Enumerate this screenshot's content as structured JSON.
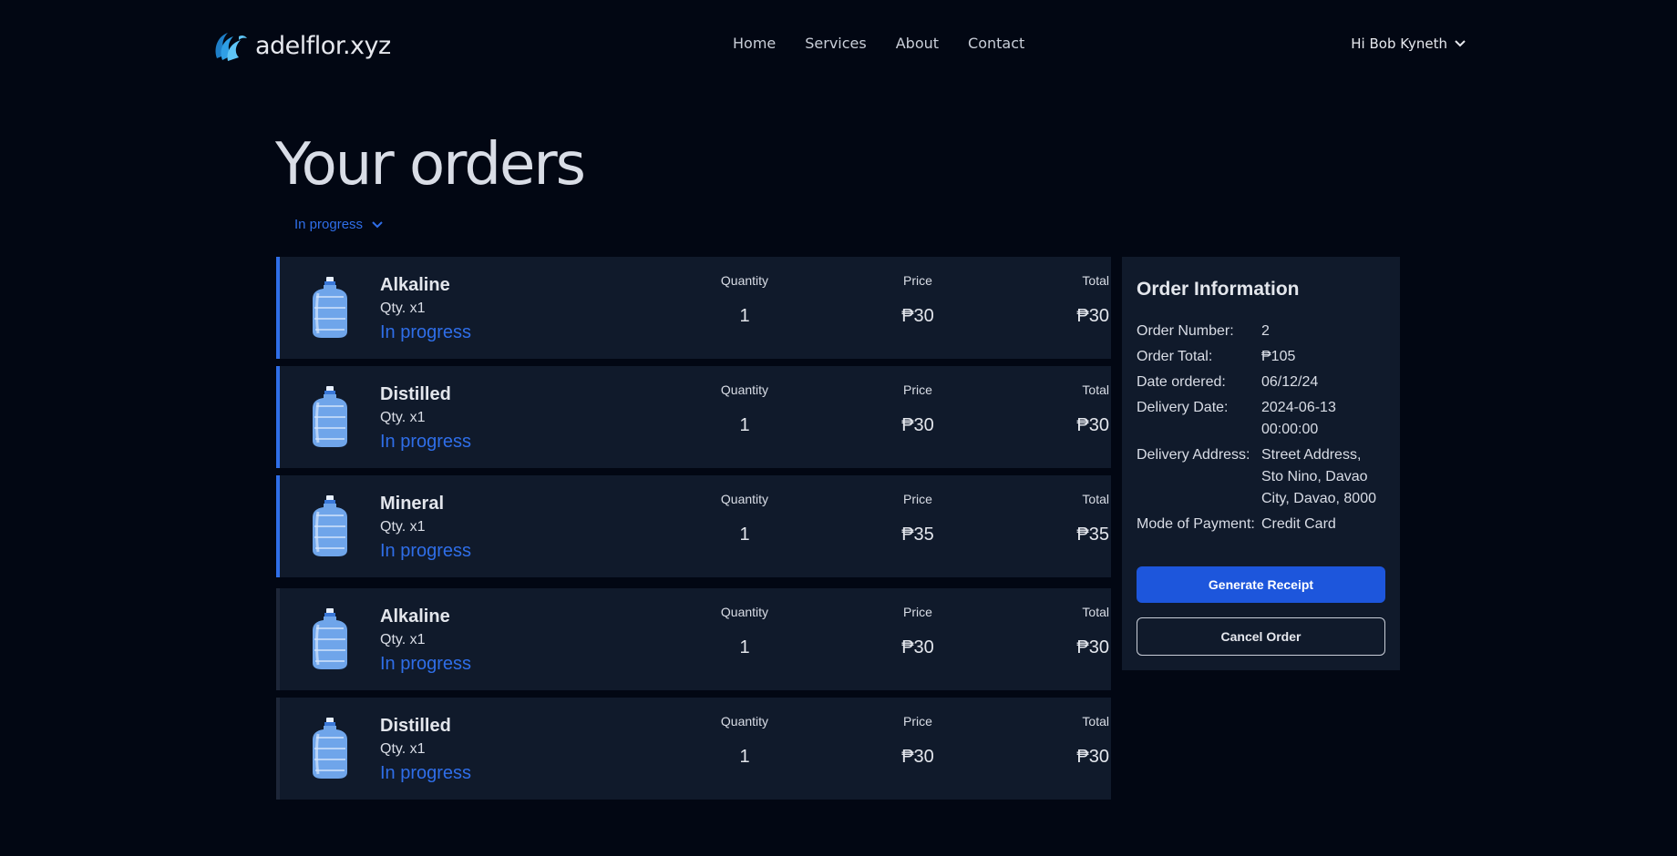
{
  "header": {
    "logo_text": "adelflor.xyz",
    "nav": [
      "Home",
      "Services",
      "About",
      "Contact"
    ],
    "user_greeting": "Hi Bob Kyneth"
  },
  "page": {
    "title": "Your orders",
    "filter_value": "In progress"
  },
  "columns": {
    "quantity": "Quantity",
    "price": "Price",
    "total": "Total"
  },
  "groups": [
    {
      "active": true,
      "items": [
        {
          "name": "Alkaline",
          "qty_label": "Qty. x1",
          "status": "In progress",
          "quantity": "1",
          "price": "₱30",
          "total": "₱30"
        },
        {
          "name": "Distilled",
          "qty_label": "Qty. x1",
          "status": "In progress",
          "quantity": "1",
          "price": "₱30",
          "total": "₱30"
        },
        {
          "name": "Mineral",
          "qty_label": "Qty. x1",
          "status": "In progress",
          "quantity": "1",
          "price": "₱35",
          "total": "₱35"
        }
      ]
    },
    {
      "active": false,
      "items": [
        {
          "name": "Alkaline",
          "qty_label": "Qty. x1",
          "status": "In progress",
          "quantity": "1",
          "price": "₱30",
          "total": "₱30"
        },
        {
          "name": "Distilled",
          "qty_label": "Qty. x1",
          "status": "In progress",
          "quantity": "1",
          "price": "₱30",
          "total": "₱30"
        }
      ]
    }
  ],
  "order_info": {
    "heading": "Order Information",
    "rows": [
      {
        "label": "Order Number:",
        "value": "2"
      },
      {
        "label": "Order Total:",
        "value": "₱105"
      },
      {
        "label": "Date ordered:",
        "value": "06/12/24"
      },
      {
        "label": "Delivery Date:",
        "value": "2024-06-13 00:00:00"
      },
      {
        "label": "Delivery Address:",
        "value": "Street Address, Sto Nino, Davao City, Davao, 8000"
      },
      {
        "label": "Mode of Payment:",
        "value": "Credit Card"
      }
    ],
    "generate_receipt_label": "Generate Receipt",
    "cancel_order_label": "Cancel Order"
  },
  "colors": {
    "background": "#020713",
    "card": "#101a2b",
    "accent": "#2f6ee8",
    "button": "#1d56dc"
  }
}
